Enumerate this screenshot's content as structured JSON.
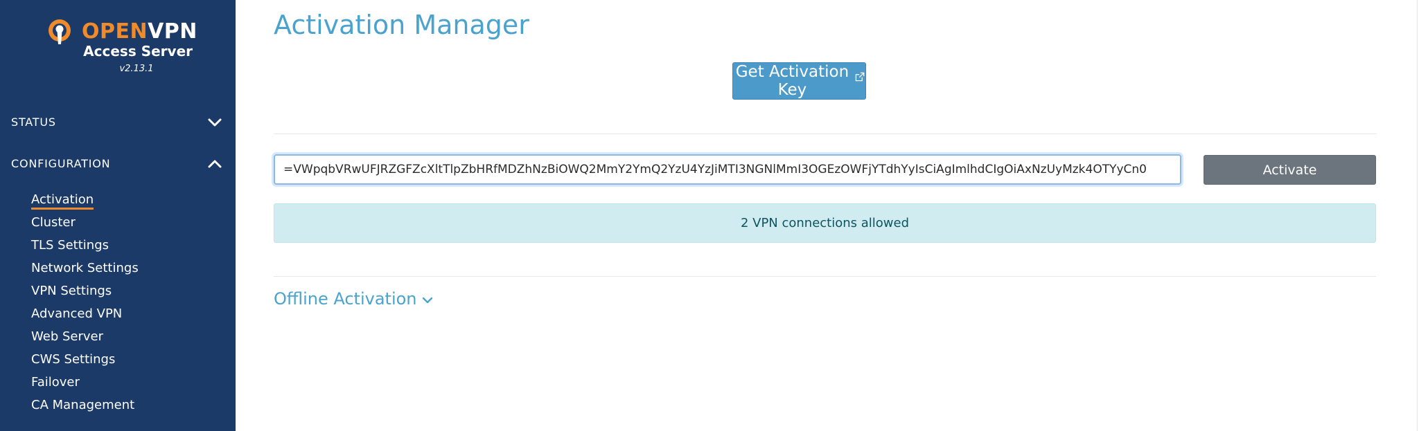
{
  "brand": {
    "name_part1": "OPEN",
    "name_part2": "VPN",
    "subtitle": "Access Server",
    "version": "v2.13.1",
    "logo_icon": "openvpn-keyhole-icon",
    "accent_color": "#f08a2b",
    "sidebar_color": "#1b3a67"
  },
  "sidebar": {
    "sections": [
      {
        "label": "STATUS",
        "expanded": false,
        "icon": "chevron-down-icon"
      },
      {
        "label": "CONFIGURATION",
        "expanded": true,
        "icon": "chevron-up-icon"
      }
    ],
    "items": [
      {
        "label": "Activation",
        "active": true
      },
      {
        "label": "Cluster"
      },
      {
        "label": "TLS Settings"
      },
      {
        "label": "Network Settings"
      },
      {
        "label": "VPN Settings"
      },
      {
        "label": "Advanced VPN"
      },
      {
        "label": "Web Server"
      },
      {
        "label": "CWS Settings"
      },
      {
        "label": "Failover"
      },
      {
        "label": "CA Management"
      }
    ]
  },
  "main": {
    "title": "Activation Manager",
    "get_key_button": {
      "label": "Get Activation Key",
      "icon": "external-link-icon"
    },
    "activation_key_value": "VWpqbVRwUFJRZGFZcXltTlpZbHRfMDZhNzBiOWQ2MmY2YmQ2YzU4YzJiMTI3NGNlMmI3OGEzOWFjYTdhYyIsCiAgImlhdCIgOiAxNzUyMzk4OTYyCn0=",
    "activate_button": "Activate",
    "info_message": "2 VPN connections allowed",
    "offline_activation_label": "Offline Activation",
    "title_color": "#4aa3cf",
    "info_bg_color": "#d1ecf1"
  }
}
